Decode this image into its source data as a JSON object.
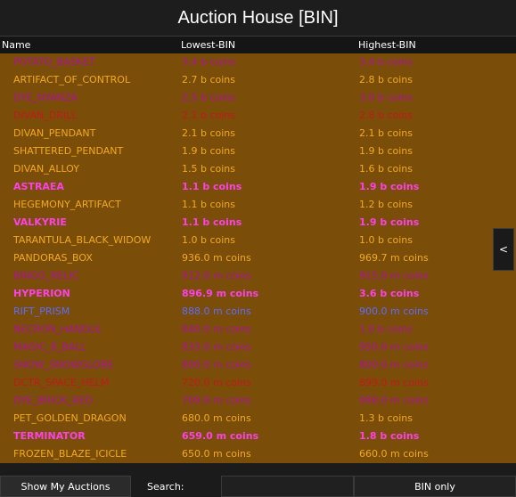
{
  "title": "Auction House [BIN]",
  "columns": {
    "name": "Name",
    "lowest": "Lowest-BIN",
    "highest": "Highest-BIN"
  },
  "colors": {
    "list_bg": "#7a4e08",
    "legendary": "#f0a81c",
    "epic": "#a5159f",
    "mythic": "#ff3ae0",
    "special": "#d21818",
    "divine": "#5a6fff"
  },
  "rows": [
    {
      "name": "POTATO_BASKET",
      "lowest": "3.4 b coins",
      "highest": "3.4 b coins",
      "color": "#b01298",
      "bold": false
    },
    {
      "name": "ARTIFACT_OF_CONTROL",
      "lowest": "2.7 b coins",
      "highest": "2.8 b coins",
      "color": "#f2a91c",
      "bold": false
    },
    {
      "name": "DYE_NYANZA",
      "lowest": "2.5 b coins",
      "highest": "3.0 b coins",
      "color": "#b01298",
      "bold": false
    },
    {
      "name": "DIVAN_DRILL",
      "lowest": "2.1 b coins",
      "highest": "2.8 b coins",
      "color": "#c4181e",
      "bold": false
    },
    {
      "name": "DIVAN_PENDANT",
      "lowest": "2.1 b coins",
      "highest": "2.1 b coins",
      "color": "#f2a91c",
      "bold": false
    },
    {
      "name": "SHATTERED_PENDANT",
      "lowest": "1.9 b coins",
      "highest": "1.9 b coins",
      "color": "#f2a91c",
      "bold": false
    },
    {
      "name": "DIVAN_ALLOY",
      "lowest": "1.5 b coins",
      "highest": "1.6 b coins",
      "color": "#f2a91c",
      "bold": false
    },
    {
      "name": "ASTRAEA",
      "lowest": "1.1 b coins",
      "highest": "1.9 b coins",
      "color": "#ff40e6",
      "bold": true
    },
    {
      "name": "HEGEMONY_ARTIFACT",
      "lowest": "1.1 b coins",
      "highest": "1.2 b coins",
      "color": "#f2a91c",
      "bold": false
    },
    {
      "name": "VALKYRIE",
      "lowest": "1.1 b coins",
      "highest": "1.9 b coins",
      "color": "#ff40e6",
      "bold": true
    },
    {
      "name": "TARANTULA_BLACK_WIDOW",
      "lowest": "1.0 b coins",
      "highest": "1.0 b coins",
      "color": "#f2a91c",
      "bold": false
    },
    {
      "name": "PANDORAS_BOX",
      "lowest": "936.0 m coins",
      "highest": "969.7 m coins",
      "color": "#f2a91c",
      "bold": false
    },
    {
      "name": "BINGO_RELIC",
      "lowest": "912.0 m coins",
      "highest": "915.0 m coins",
      "color": "#b01298",
      "bold": false
    },
    {
      "name": "HYPERION",
      "lowest": "896.9 m coins",
      "highest": "3.6 b coins",
      "color": "#ff40e6",
      "bold": true
    },
    {
      "name": "RIFT_PRISM",
      "lowest": "888.0 m coins",
      "highest": "900.0 m coins",
      "color": "#5c6cff",
      "bold": false
    },
    {
      "name": "NECRON_HANDLE",
      "lowest": "840.0 m coins",
      "highest": "1.0 b coins",
      "color": "#b01298",
      "bold": false
    },
    {
      "name": "MAGIC_8_BALL",
      "lowest": "833.0 m coins",
      "highest": "950.0 m coins",
      "color": "#b01298",
      "bold": false
    },
    {
      "name": "SNOW_SNOWGLOBE",
      "lowest": "800.0 m coins",
      "highest": "800.0 m coins",
      "color": "#b01298",
      "bold": false
    },
    {
      "name": "DCTR_SPACE_HELM",
      "lowest": "720.0 m coins",
      "highest": "899.0 m coins",
      "color": "#c4181e",
      "bold": false
    },
    {
      "name": "DYE_BRICK_RED",
      "lowest": "709.9 m coins",
      "highest": "998.0 m coins",
      "color": "#b01298",
      "bold": false
    },
    {
      "name": "PET_GOLDEN_DRAGON",
      "lowest": "680.0 m coins",
      "highest": "1.3 b coins",
      "color": "#f2a91c",
      "bold": false
    },
    {
      "name": "TERMINATOR",
      "lowest": "659.0 m coins",
      "highest": "1.8 b coins",
      "color": "#ff40e6",
      "bold": true
    },
    {
      "name": "FROZEN_BLAZE_ICICLE",
      "lowest": "650.0 m coins",
      "highest": "660.0 m coins",
      "color": "#f2a91c",
      "bold": false
    }
  ],
  "side_button_label": "<",
  "bottom": {
    "show_my_auctions": "Show My Auctions",
    "search_label": "Search:",
    "search_value": "",
    "bin_only": "BIN only"
  }
}
